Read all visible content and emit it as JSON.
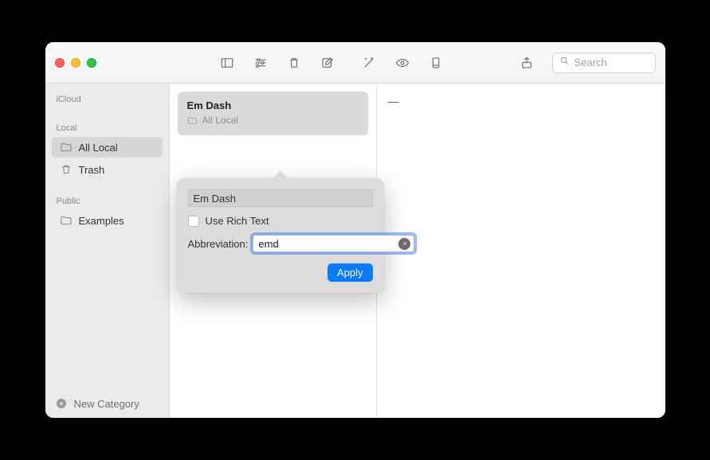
{
  "search": {
    "placeholder": "Search"
  },
  "sidebar": {
    "sections": [
      {
        "label": "iCloud",
        "items": []
      },
      {
        "label": "Local",
        "items": [
          {
            "id": "all-local",
            "label": "All Local",
            "icon": "folder",
            "selected": true
          },
          {
            "id": "trash",
            "label": "Trash",
            "icon": "trash",
            "selected": false
          }
        ]
      },
      {
        "label": "Public",
        "items": [
          {
            "id": "examples",
            "label": "Examples",
            "icon": "folder",
            "selected": false
          }
        ]
      }
    ],
    "footer": {
      "label": "New Category"
    }
  },
  "snippets": [
    {
      "title": "Em Dash",
      "category": "All Local"
    }
  ],
  "detail": {
    "content": "—"
  },
  "popover": {
    "name": "Em Dash",
    "rich_text_label": "Use Rich Text",
    "rich_text_checked": false,
    "abbrev_label": "Abbreviation:",
    "abbrev_value": "emd",
    "apply_label": "Apply"
  }
}
